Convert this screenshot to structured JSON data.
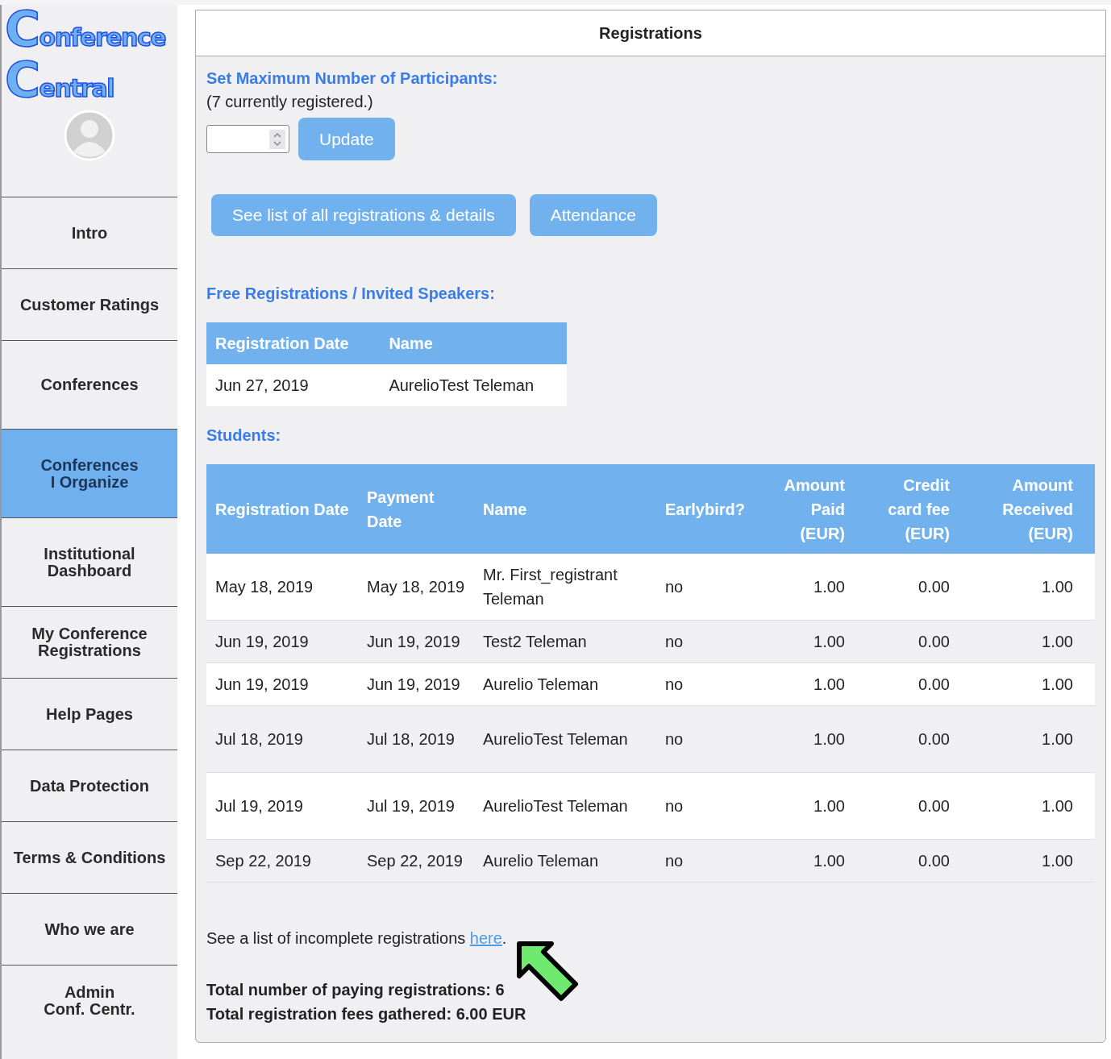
{
  "logo": {
    "lines": [
      "Conference",
      "Central"
    ]
  },
  "sidebar": {
    "items": [
      {
        "lines": [
          "Intro"
        ],
        "selected": false
      },
      {
        "lines": [
          "Customer Ratings"
        ],
        "selected": false
      },
      {
        "lines": [
          "Conferences"
        ],
        "selected": false
      },
      {
        "lines": [
          "Conferences",
          "I Organize"
        ],
        "selected": true
      },
      {
        "lines": [
          "Institutional",
          "Dashboard"
        ],
        "selected": false
      },
      {
        "lines": [
          "My Conference",
          "Registrations"
        ],
        "selected": false
      },
      {
        "lines": [
          "Help Pages"
        ],
        "selected": false
      },
      {
        "lines": [
          "Data Protection"
        ],
        "selected": false
      },
      {
        "lines": [
          "Terms & Conditions"
        ],
        "selected": false
      },
      {
        "lines": [
          "Who we are"
        ],
        "selected": false
      },
      {
        "lines": [
          "Admin",
          "Conf. Centr."
        ],
        "selected": false
      }
    ]
  },
  "panel": {
    "title": "Registrations",
    "max_participants": {
      "heading": "Set Maximum Number of Participants:",
      "note": "(7 currently registered.)",
      "button": "Update"
    },
    "buttons": [
      "See list of all registrations & details",
      "Attendance"
    ],
    "free": {
      "heading": "Free Registrations / Invited Speakers:",
      "columns": [
        "Registration Date",
        "Name"
      ],
      "rows": [
        [
          "Jun 27, 2019",
          "AurelioTest Teleman"
        ]
      ]
    },
    "students": {
      "heading": "Students:",
      "columns": [
        "Registration Date",
        "Payment Date",
        "Name",
        "Earlybird?",
        "Amount Paid (EUR)",
        "Credit card fee (EUR)",
        "Amount Received (EUR)"
      ],
      "rows": [
        [
          "May 18, 2019",
          "May 18, 2019",
          "Mr. First_registrant Teleman",
          "no",
          "1.00",
          "0.00",
          "1.00"
        ],
        [
          "Jun 19, 2019",
          "Jun 19, 2019",
          "Test2 Teleman",
          "no",
          "1.00",
          "0.00",
          "1.00"
        ],
        [
          "Jun 19, 2019",
          "Jun 19, 2019",
          "Aurelio Teleman",
          "no",
          "1.00",
          "0.00",
          "1.00"
        ],
        [
          "Jul 18, 2019",
          "Jul 18, 2019",
          "AurelioTest Teleman",
          "no",
          "1.00",
          "0.00",
          "1.00"
        ],
        [
          "Jul 19, 2019",
          "Jul 19, 2019",
          "AurelioTest Teleman",
          "no",
          "1.00",
          "0.00",
          "1.00"
        ],
        [
          "Sep 22, 2019",
          "Sep 22, 2019",
          "Aurelio Teleman",
          "no",
          "1.00",
          "0.00",
          "1.00"
        ]
      ]
    },
    "incomplete": {
      "text": "See a list of incomplete registrations ",
      "link": "here",
      "after": "."
    },
    "totals": [
      "Total number of paying registrations: 6",
      "Total registration fees gathered: 6.00 EUR"
    ]
  }
}
